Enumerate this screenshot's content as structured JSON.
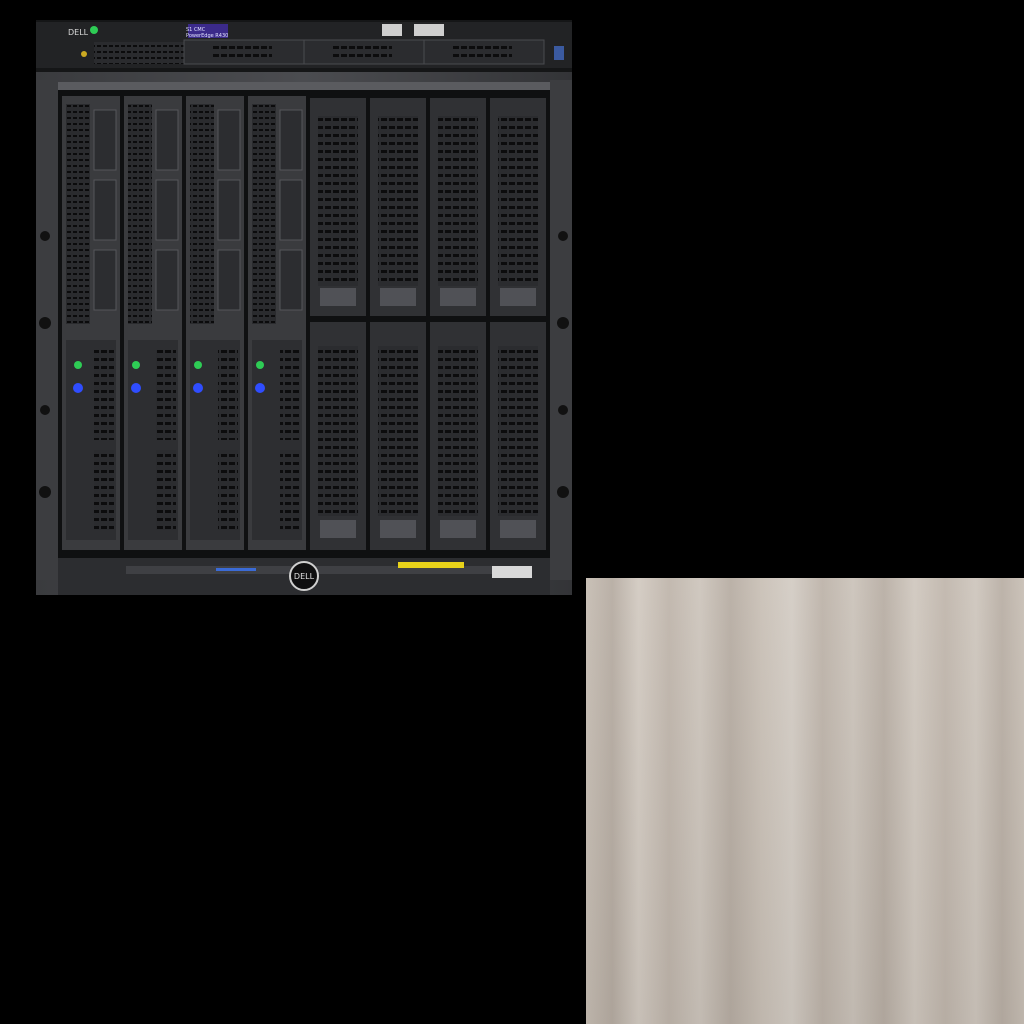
{
  "photo": {
    "top_unit": {
      "brand": "DELL",
      "lcd_line1": "S1 CMC",
      "lcd_line2": "PowerEdge R430"
    },
    "chassis": {
      "logo": "DELL",
      "populated_blades": 4,
      "empty_slot_blanks": 8,
      "blade_led_colors": {
        "status": "#2ecc55",
        "identify": "#2f4dff"
      }
    }
  },
  "cloth": {
    "description_color": "#c6bdb3"
  }
}
